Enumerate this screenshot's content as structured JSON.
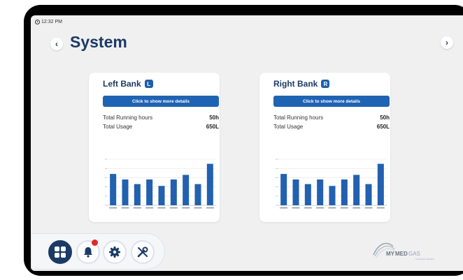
{
  "status_bar": {
    "time": "12:32 PM"
  },
  "header": {
    "title": "System",
    "back_icon": "chevron-left-icon",
    "next_icon": "chevron-right-icon"
  },
  "banks": [
    {
      "title": "Left Bank",
      "badge": "L",
      "details_button": "Click to show more details",
      "running_hours_label": "Total Running hours",
      "running_hours_value": "50h",
      "usage_label": "Total Usage",
      "usage_value": "650L"
    },
    {
      "title": "Right Bank",
      "badge": "R",
      "details_button": "Click to show more details",
      "running_hours_label": "Total Running hours",
      "running_hours_value": "50h",
      "usage_label": "Total Usage",
      "usage_value": "650L"
    }
  ],
  "chart_data": [
    {
      "type": "bar",
      "categories": [
        "1",
        "2",
        "3",
        "4",
        "5",
        "6",
        "7",
        "8",
        "9"
      ],
      "values": [
        6.8,
        5.6,
        4.6,
        5.6,
        4.2,
        5.6,
        6.6,
        4.6,
        9.0
      ],
      "ylim": [
        0,
        10
      ],
      "grid": true,
      "bar_color": "#2260b0"
    },
    {
      "type": "bar",
      "categories": [
        "1",
        "2",
        "3",
        "4",
        "5",
        "6",
        "7",
        "8",
        "9"
      ],
      "values": [
        6.8,
        5.6,
        4.6,
        5.6,
        4.2,
        5.6,
        6.6,
        4.6,
        9.0
      ],
      "ylim": [
        0,
        10
      ],
      "grid": true,
      "bar_color": "#2260b0"
    }
  ],
  "bottom_nav": [
    {
      "icon": "dashboard-icon",
      "active": true
    },
    {
      "icon": "bell-icon",
      "active": false,
      "alert": true
    },
    {
      "icon": "gear-icon",
      "active": false
    },
    {
      "icon": "wrench-icon",
      "active": false
    }
  ],
  "logo": {
    "text_1": "MY",
    "text_2": "MED",
    "text_3": "GAS",
    "tagline": "by Pressure Monitor"
  },
  "colors": {
    "primary": "#1b3a66",
    "button": "#1f63b3",
    "alert": "#e02828",
    "background": "#f0f0f1"
  }
}
